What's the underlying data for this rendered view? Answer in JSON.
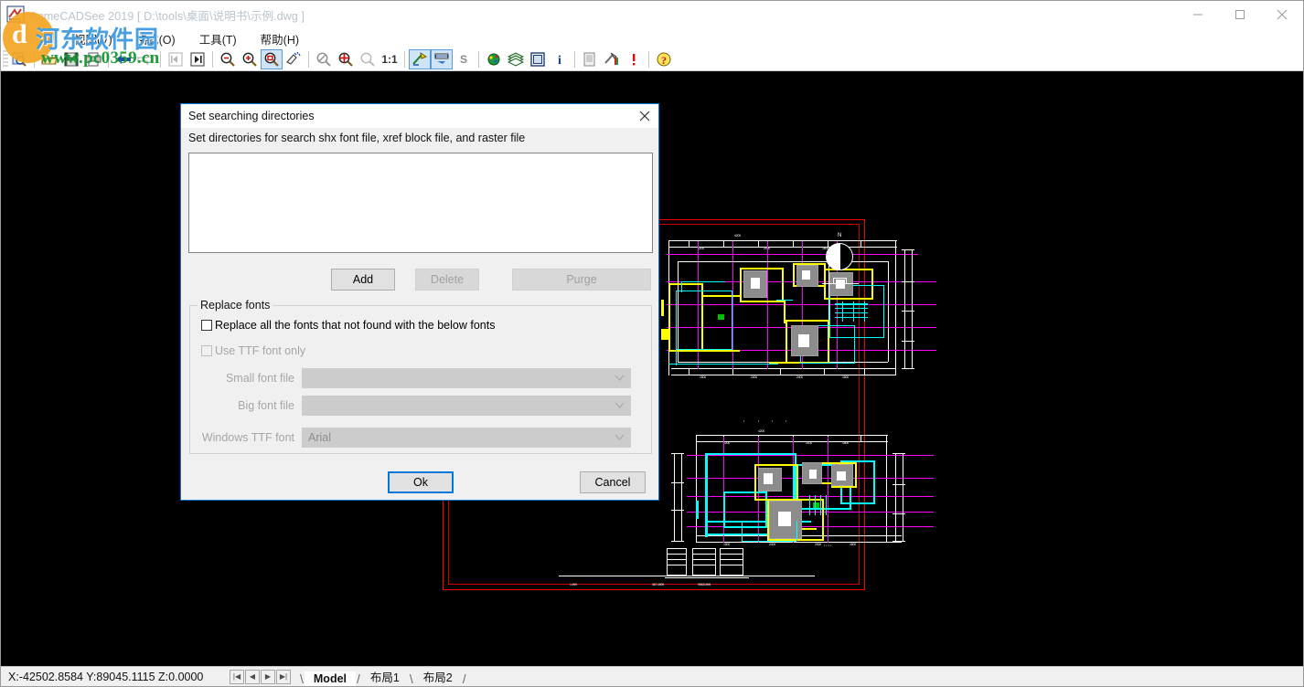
{
  "window": {
    "title": "AcmeCADSee 2019 [ D:\\tools\\桌面\\说明书\\示例.dwg ]",
    "app_icon": "acmecadsee-icon",
    "minimize_label": "—",
    "maximize_label": "□",
    "close_label": "✕"
  },
  "menu": {
    "items": [
      {
        "label": "文件(F)",
        "name": "menu-file",
        "dim": true
      },
      {
        "label": "视图(V)",
        "name": "menu-view",
        "dim": false
      },
      {
        "label": "格式(O)",
        "name": "menu-format",
        "dim": false
      },
      {
        "label": "工具(T)",
        "name": "menu-tools",
        "dim": false
      },
      {
        "label": "帮助(H)",
        "name": "menu-help",
        "dim": false
      }
    ]
  },
  "toolbar": {
    "buttons": [
      {
        "name": "preview-icon",
        "tip": "Preview"
      },
      {
        "name": "open-folder-icon",
        "tip": "Open"
      },
      {
        "name": "save-icon",
        "tip": "Save"
      },
      {
        "name": "print-icon",
        "tip": "Print"
      },
      {
        "name": "arrow-left-icon",
        "tip": "Previous"
      },
      {
        "name": "arrow-right-icon",
        "tip": "Next"
      },
      {
        "name": "first-page-icon",
        "tip": "First"
      },
      {
        "name": "last-page-icon",
        "tip": "Last"
      },
      {
        "name": "zoom-out-icon",
        "tip": "Zoom out"
      },
      {
        "name": "zoom-in-icon",
        "tip": "Zoom in"
      },
      {
        "name": "zoom-window-icon",
        "tip": "Zoom window",
        "active": true
      },
      {
        "name": "pan-icon",
        "tip": "Pan",
        "active": false
      },
      {
        "name": "zoom-extents-icon",
        "tip": "Zoom extents"
      },
      {
        "name": "zoom-all-icon",
        "tip": "Zoom all"
      },
      {
        "name": "zoom-previous-icon",
        "tip": "Zoom previous"
      },
      {
        "name": "scale-1to1-label",
        "tip": "1:1",
        "text": "1:1"
      },
      {
        "name": "measure-icon",
        "tip": "Measure",
        "active": true
      },
      {
        "name": "dimension-icon",
        "tip": "Dimension",
        "active": true
      },
      {
        "name": "snap-label",
        "tip": "Snap",
        "text": "S"
      },
      {
        "name": "color-icon",
        "tip": "Colors"
      },
      {
        "name": "layers-icon",
        "tip": "Layers"
      },
      {
        "name": "view-mode-icon",
        "tip": "View mode"
      },
      {
        "name": "info-icon",
        "tip": "Info"
      },
      {
        "name": "batch-icon",
        "tip": "Batch"
      },
      {
        "name": "settings-icon",
        "tip": "Settings"
      },
      {
        "name": "exclamation-icon",
        "tip": "Warning"
      },
      {
        "name": "help-icon",
        "tip": "Help"
      }
    ]
  },
  "dialog": {
    "title": "Set searching directories",
    "close_label": "✕",
    "subtitle": "Set directories for search shx font file, xref block file, and raster file",
    "list_items": [],
    "buttons": {
      "add": "Add",
      "delete": "Delete",
      "purge": "Purge",
      "ok": "Ok",
      "cancel": "Cancel"
    },
    "group": {
      "legend": "Replace fonts",
      "checkbox_replace_all": "Replace all the fonts that not found with the below fonts",
      "checkbox_replace_all_checked": false,
      "checkbox_ttf_only": "Use TTF font only",
      "checkbox_ttf_only_checked": false,
      "fields": [
        {
          "label": "Small font file",
          "value": "",
          "name": "small-font-file"
        },
        {
          "label": "Big font file",
          "value": "",
          "name": "big-font-file"
        },
        {
          "label": "Windows TTF font",
          "value": "Arial",
          "name": "windows-ttf-font"
        }
      ]
    }
  },
  "statusbar": {
    "coordinates": "X:-42502.8584 Y:89045.1115 Z:0.0000",
    "nav": {
      "first": "|◀",
      "prev": "◀",
      "next": "▶",
      "last": "▶|"
    },
    "tabs": [
      {
        "label": "Model",
        "active": true
      },
      {
        "label": "布局1",
        "active": false
      },
      {
        "label": "布局2",
        "active": false
      }
    ]
  },
  "watermark": {
    "logo_char": "d",
    "site_name": "河东软件园",
    "url": "www.pc0359.cn"
  },
  "drawing": {
    "title": "示例.dwg",
    "background": "#000000",
    "border_color": "#ff0000",
    "colors": {
      "wall": "#ffff00",
      "furniture": "#00ffff",
      "axis": "#ff00ff",
      "dimension": "#ffffff",
      "fill": "#a0a0a0",
      "marker": "#00c000"
    },
    "compass_label": "N",
    "bottom_labels": [
      "1.999",
      "367.4999",
      "99531999"
    ]
  }
}
